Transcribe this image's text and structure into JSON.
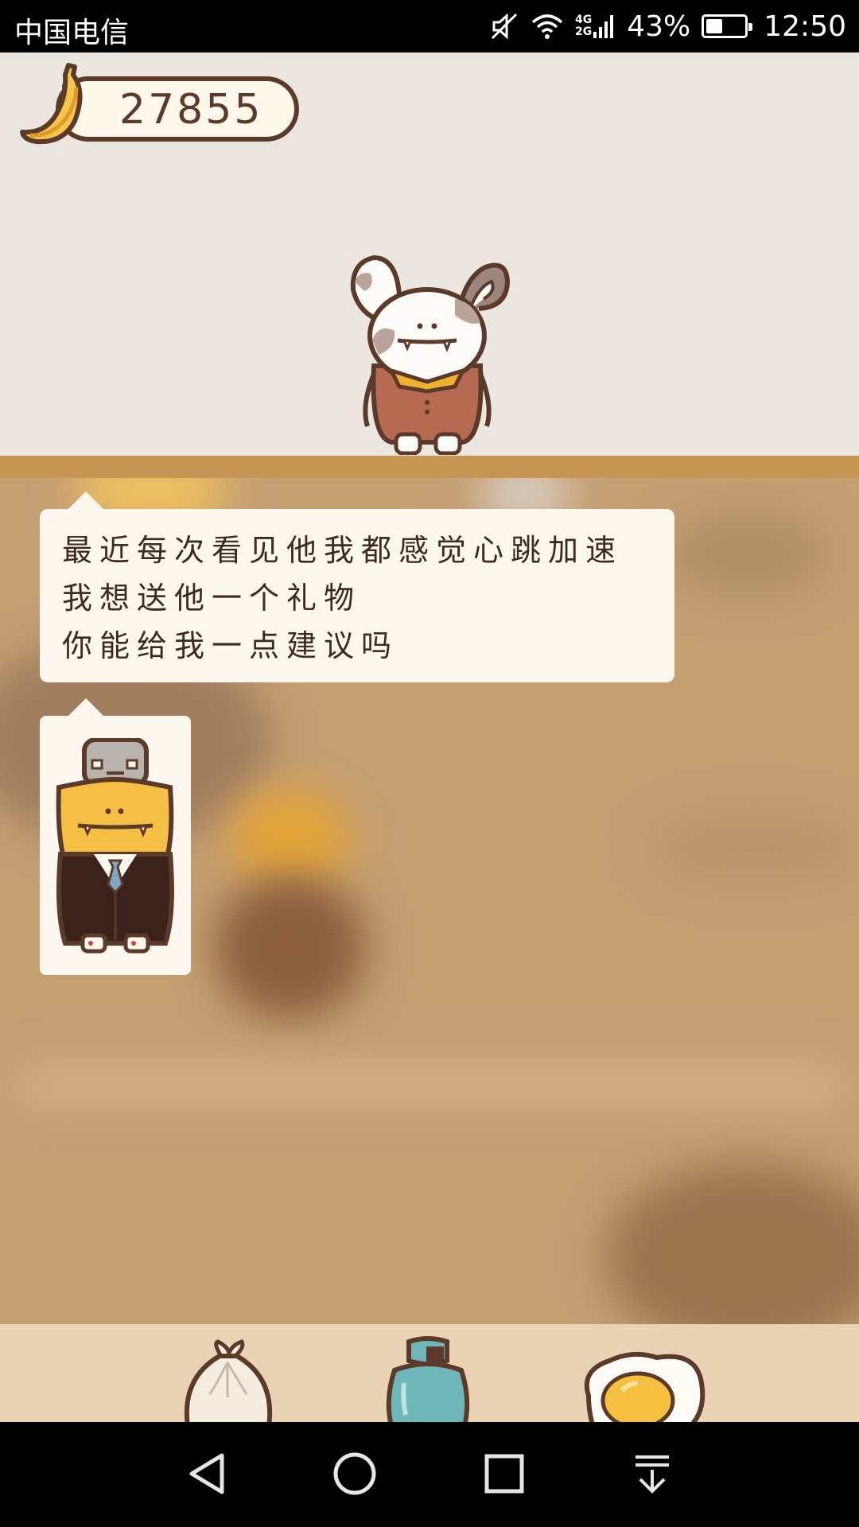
{
  "status_bar": {
    "carrier": "中国电信",
    "network_top": "4G",
    "network_bottom": "2G",
    "battery_percent": "43%",
    "battery_level": 0.43,
    "time": "12:50",
    "icons": [
      "mute-icon",
      "wifi-icon",
      "signal-icon",
      "battery-icon"
    ]
  },
  "game": {
    "banana_count": "27855",
    "speech": {
      "lines": [
        "最近每次看见他我都感觉心跳加速",
        "我想送他一个礼物",
        "你能给我一点建议吗"
      ]
    },
    "characters": [
      "rabbit-character",
      "businessman-character"
    ],
    "tray_items": [
      "dumpling-item",
      "gas-tank-item",
      "fried-egg-item"
    ]
  },
  "nav_bar": {
    "buttons": [
      "back-button",
      "home-button",
      "recents-button",
      "notification-button"
    ]
  },
  "colors": {
    "outline": "#5b3a2a",
    "bubble": "#fdf8ef",
    "shelf": "#c89654",
    "room": "#c49f72",
    "tray": "#ead3b5"
  }
}
